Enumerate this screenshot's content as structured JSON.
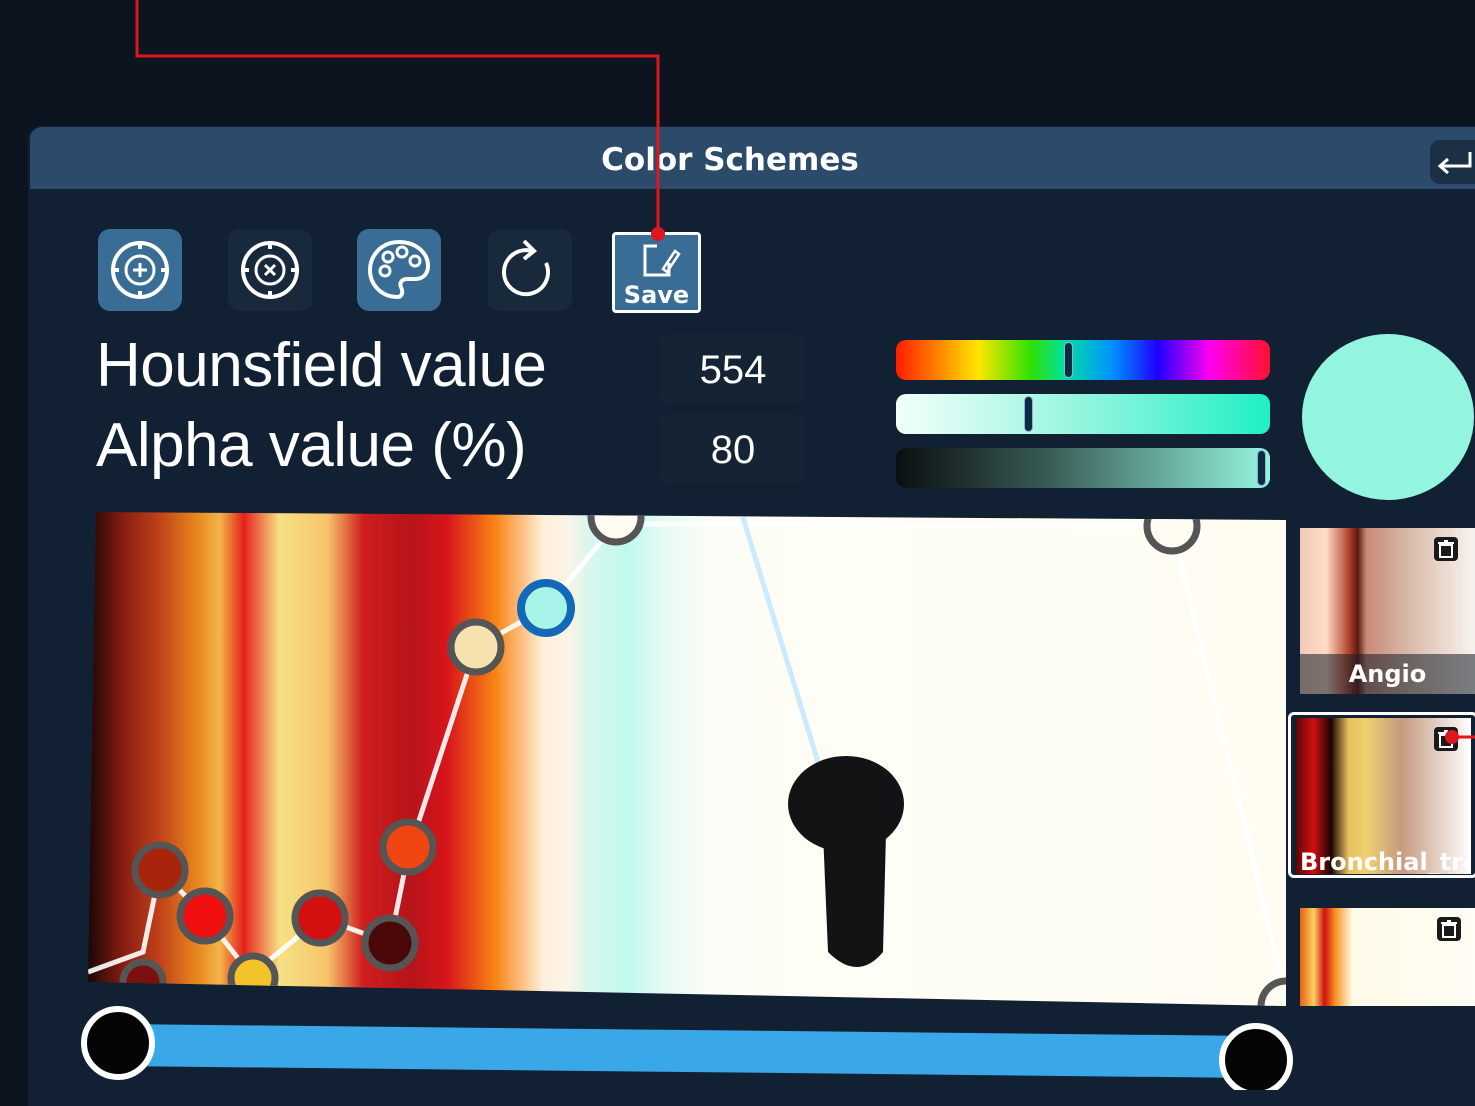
{
  "window": {
    "title": "Color Schemes",
    "back_icon": "return-arrow-icon"
  },
  "toolbar": {
    "buttons": [
      {
        "name": "add-point",
        "icon": "target-plus-icon",
        "active": true
      },
      {
        "name": "remove-point",
        "icon": "target-x-icon",
        "active": false
      },
      {
        "name": "palette",
        "icon": "palette-icon",
        "active": true
      },
      {
        "name": "reset",
        "icon": "reload-icon",
        "active": false
      }
    ],
    "save_label": "Save",
    "save_icon": "edit-document-icon"
  },
  "fields": {
    "hounsfield_label": "Hounsfield value",
    "hounsfield_value": "554",
    "alpha_label": "Alpha value (%)",
    "alpha_value": "80"
  },
  "color_picker": {
    "hue_position": 0.46,
    "saturation_position": 0.35,
    "value_position": 0.99,
    "selected_color": "#93f5df"
  },
  "transfer_function": {
    "selected_point_color": "#a8f4e8",
    "range_slider": {
      "min": 0.0,
      "max": 1.0
    }
  },
  "presets": [
    {
      "label": "Angio",
      "selected": false
    },
    {
      "label": "Bronchial_tree",
      "selected": true
    },
    {
      "label": "",
      "selected": false
    }
  ],
  "colors": {
    "accent": "#3aa8e8",
    "annotation": "#e0161e",
    "panel": "#112133"
  }
}
